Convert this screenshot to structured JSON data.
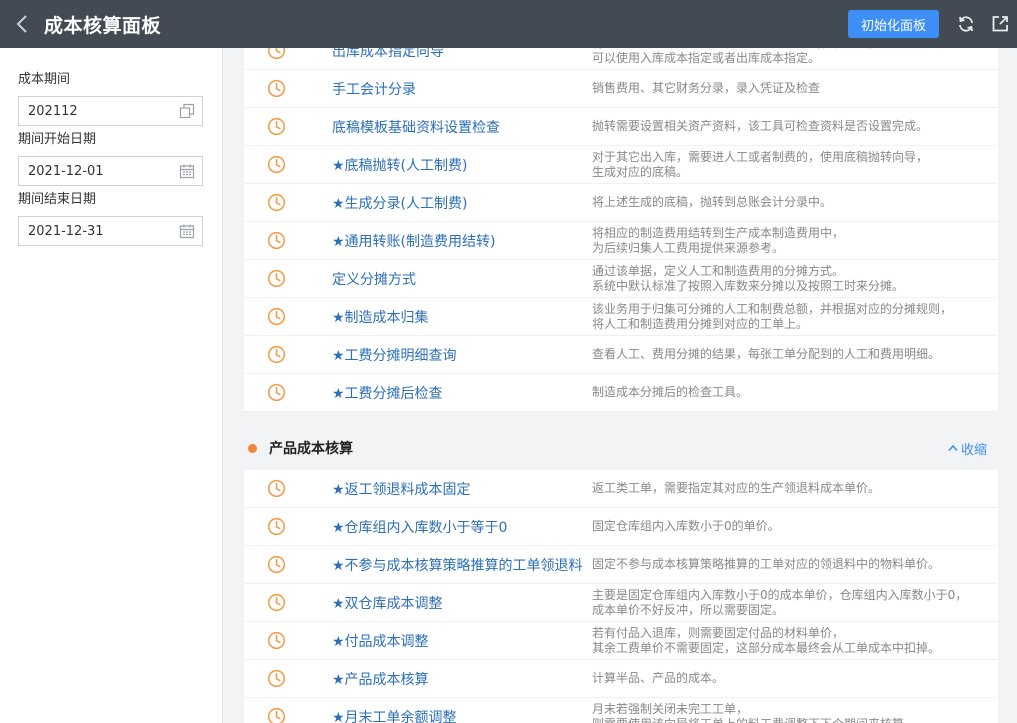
{
  "header": {
    "title": "成本核算面板",
    "init_button": "初始化面板"
  },
  "sidebar": {
    "fields": [
      {
        "label": "成本期间",
        "value": "202112",
        "icon": "copy-icon"
      },
      {
        "label": "期间开始日期",
        "value": "2021-12-01",
        "icon": "calendar-icon"
      },
      {
        "label": "期间结束日期",
        "value": "2021-12-31",
        "icon": "calendar-icon"
      }
    ]
  },
  "section1": {
    "rows": [
      {
        "name": "出库成本指定向导",
        "desc": "有些其它出入库单想要抛转到总账的人工或者制费中，\n可以使用入库成本指定或者出库成本指定。"
      },
      {
        "name": "手工会计分录",
        "desc": "销售费用、其它财务分录，录入凭证及检查"
      },
      {
        "name": "底稿模板基础资料设置检查",
        "desc": "抛转需要设置相关资产资料，该工具可检查资料是否设置完成。"
      },
      {
        "name": "★底稿抛转(人工制费)",
        "desc": "对于其它出入库，需要进人工或者制费的，使用底稿抛转向导，\n生成对应的底稿。"
      },
      {
        "name": "★生成分录(人工制费)",
        "desc": "将上述生成的底稿，抛转到总账会计分录中。"
      },
      {
        "name": "★通用转账(制造费用结转)",
        "desc": "将相应的制造费用结转到生产成本制造费用中，\n为后续归集人工费用提供来源参考。"
      },
      {
        "name": "定义分摊方式",
        "desc": "通过该单据，定义人工和制造费用的分摊方式。\n系统中默认标准了按照入库数来分摊以及按照工时来分摊。"
      },
      {
        "name": "★制造成本归集",
        "desc": "该业务用于归集可分摊的人工和制费总额，并根据对应的分摊规则，\n将人工和制造费用分摊到对应的工单上。"
      },
      {
        "name": "★工费分摊明细查询",
        "desc": "查看人工、费用分摊的结果，每张工单分配到的人工和费用明细。"
      },
      {
        "name": "★工费分摊后检查",
        "desc": "制造成本分摊后的检查工具。"
      }
    ]
  },
  "section2": {
    "title": "产品成本核算",
    "collapse_label": "收缩",
    "rows": [
      {
        "name": "★返工领退料成本固定",
        "desc": "返工类工单，需要指定其对应的生产领退料成本单价。"
      },
      {
        "name": "★仓库组内入库数小于等于0",
        "desc": "固定仓库组内入库数小于0的单价。"
      },
      {
        "name": "★不参与成本核算策略推算的工单领退料",
        "desc": "固定不参与成本核算策略推算的工单对应的领退料中的物料单价。"
      },
      {
        "name": "★双仓库成本调整",
        "desc": "主要是固定仓库组内入库数小于0的成本单价，仓库组内入库数小于0，\n成本单价不好反冲，所以需要固定。"
      },
      {
        "name": "★付品成本调整",
        "desc": "若有付品入退库，则需要固定付品的材料单价，\n其余工费单价不需要固定，这部分成本最终会从工单成本中扣掉。"
      },
      {
        "name": "★产品成本核算",
        "desc": "计算半品、产品的成本。"
      },
      {
        "name": "★月末工单余额调整",
        "desc": "月末若强制关闭未完工工单，\n则需要使用该向导将工单上的料工费调整下下个期间来核算。"
      }
    ]
  },
  "colors": {
    "topbar": "#424a54",
    "accent": "#3d8ef5",
    "link": "#2d6fb8",
    "clock_icon": "#f0a04b",
    "section_dot": "#f0863a"
  }
}
